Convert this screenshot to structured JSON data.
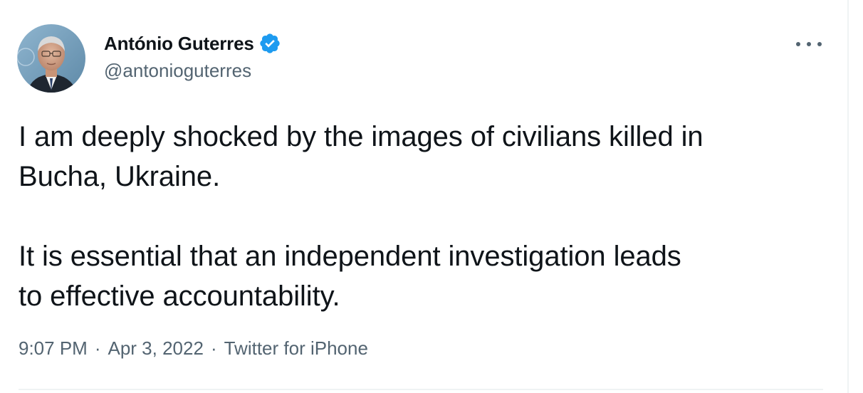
{
  "author": {
    "display_name": "António Guterres",
    "handle": "@antonioguterres",
    "verified": true,
    "avatar_icon": "avatar-photo",
    "verified_icon": "verified-badge-icon",
    "verified_color": "#1d9bf0"
  },
  "tweet": {
    "text": "I am deeply shocked by the images of civilians killed in\nBucha, Ukraine.\n\nIt is essential that an independent investigation leads\nto effective accountability.",
    "time": "9:07 PM",
    "separator": "·",
    "date": "Apr 3, 2022",
    "source": "Twitter for iPhone"
  },
  "actions": {
    "more_icon": "more-options-icon"
  },
  "colors": {
    "text_primary": "#0f1419",
    "text_secondary": "#536471",
    "divider": "#eff3f4"
  }
}
